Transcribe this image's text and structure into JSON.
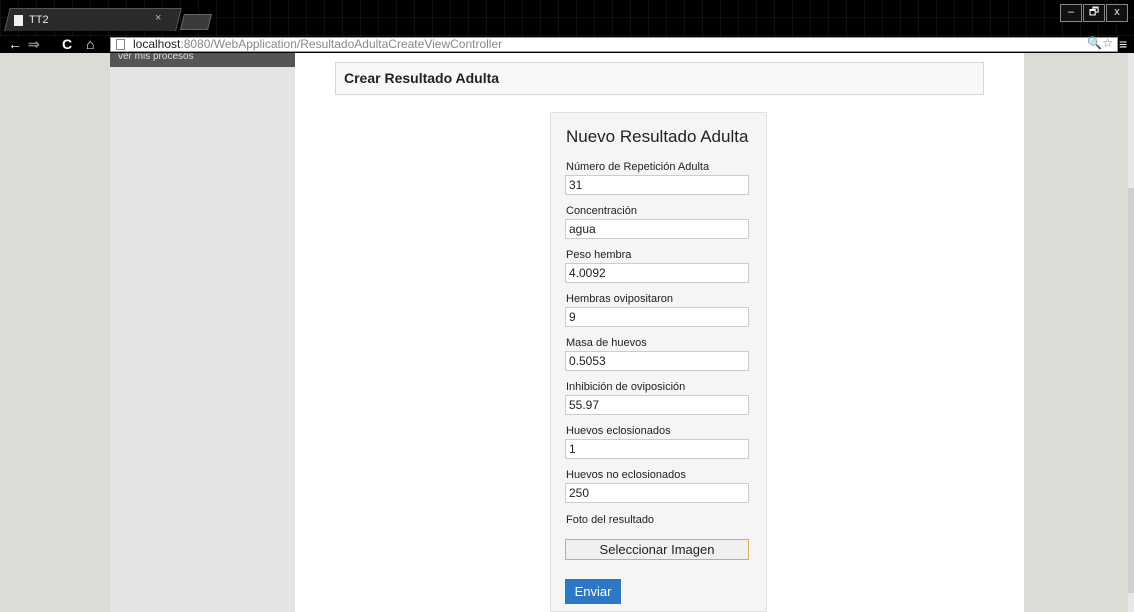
{
  "browser": {
    "tab_title": "TT2",
    "tab_close": "×",
    "url_host": "localhost",
    "url_rest": ":8080/WebApplication/ResultadoAdultaCreateViewController",
    "window_controls": [
      "–",
      "🗗",
      "x"
    ]
  },
  "sidebar": {
    "top_text": "ver mis procesos"
  },
  "page": {
    "heading": "Crear Resultado Adulta"
  },
  "form": {
    "title": "Nuevo Resultado Adulta",
    "fields": [
      {
        "label": "Número de Repetición Adulta",
        "value": "31"
      },
      {
        "label": "Concentración",
        "value": "agua"
      },
      {
        "label": "Peso hembra",
        "value": "4.0092"
      },
      {
        "label": "Hembras ovipositaron",
        "value": "9"
      },
      {
        "label": "Masa de huevos",
        "value": "0.5053"
      },
      {
        "label": "Inhibición de oviposición",
        "value": "55.97"
      },
      {
        "label": "Huevos eclosionados",
        "value": "1"
      },
      {
        "label": "Huevos no eclosionados",
        "value": "250"
      }
    ],
    "photo_label": "Foto del resultado",
    "select_image_label": "Seleccionar Imagen",
    "submit_label": "Enviar"
  },
  "colors": {
    "submit_button": "#2d78c4",
    "select_button_border": "#e0a850"
  }
}
